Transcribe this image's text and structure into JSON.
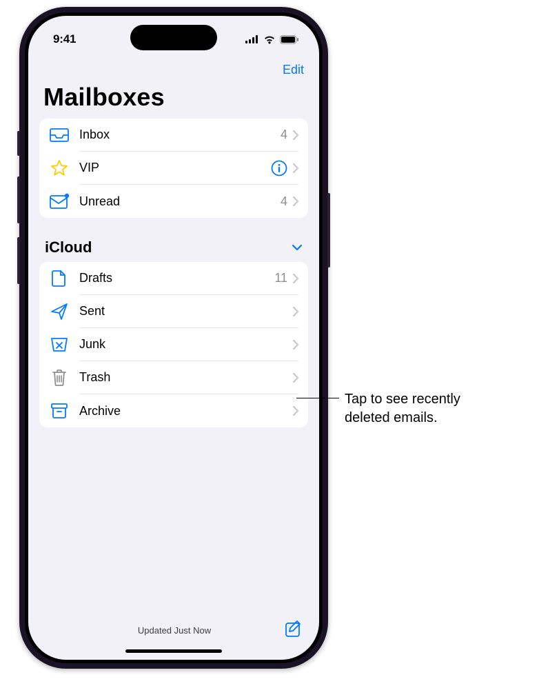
{
  "status": {
    "time": "9:41"
  },
  "nav": {
    "edit": "Edit"
  },
  "title": "Mailboxes",
  "smart_mailboxes": [
    {
      "icon": "inbox",
      "label": "Inbox",
      "count": "4",
      "info": false
    },
    {
      "icon": "star",
      "label": "VIP",
      "count": "",
      "info": true
    },
    {
      "icon": "unread",
      "label": "Unread",
      "count": "4",
      "info": false
    }
  ],
  "section": {
    "title": "iCloud"
  },
  "icloud_mailboxes": [
    {
      "icon": "drafts",
      "label": "Drafts",
      "count": "11"
    },
    {
      "icon": "sent",
      "label": "Sent",
      "count": ""
    },
    {
      "icon": "junk",
      "label": "Junk",
      "count": ""
    },
    {
      "icon": "trash",
      "label": "Trash",
      "count": ""
    },
    {
      "icon": "archive",
      "label": "Archive",
      "count": ""
    }
  ],
  "footer": {
    "updated": "Updated Just Now"
  },
  "callout": {
    "text": "Tap to see recently\ndeleted emails."
  },
  "colors": {
    "accent": "#007aff",
    "star": "#ffcc00",
    "secondary": "#8e8e93"
  }
}
